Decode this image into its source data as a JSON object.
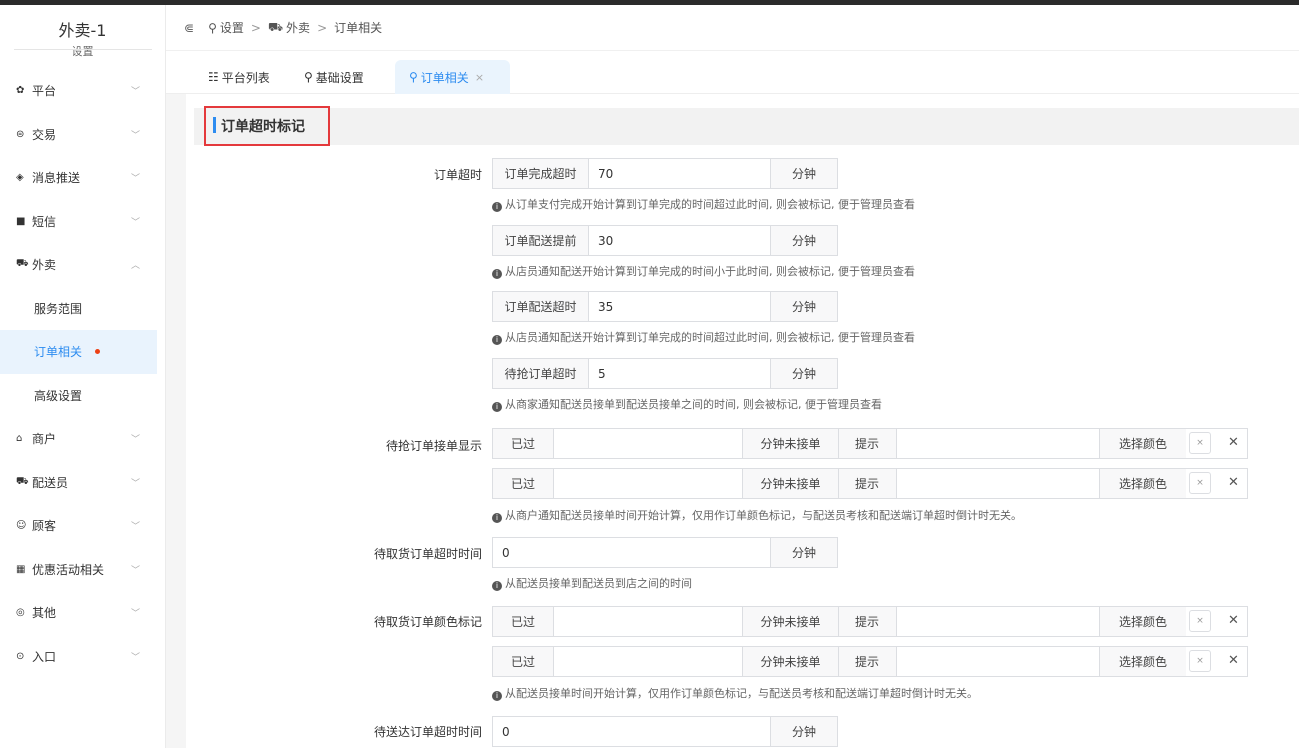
{
  "brand": {
    "title": "外卖-1",
    "subtitle": "设置"
  },
  "sidebar": {
    "items": [
      {
        "icon": "gear-icon",
        "glyph": "✿",
        "label": "平台"
      },
      {
        "icon": "trade-icon",
        "glyph": "⊜",
        "label": "交易"
      },
      {
        "icon": "message-icon",
        "glyph": "◈",
        "label": "消息推送"
      },
      {
        "icon": "sms-icon",
        "glyph": "■",
        "label": "短信"
      },
      {
        "icon": "takeout-icon",
        "glyph": "⛟",
        "label": "外卖"
      }
    ],
    "sub_items": [
      {
        "label": "服务范围"
      },
      {
        "label": "订单相关"
      },
      {
        "label": "高级设置"
      }
    ],
    "items_after": [
      {
        "icon": "shop-icon",
        "glyph": "⌂",
        "label": "商户"
      },
      {
        "icon": "rider-icon",
        "glyph": "⛟",
        "label": "配送员"
      },
      {
        "icon": "customer-icon",
        "glyph": "☺",
        "label": "顾客"
      },
      {
        "icon": "gift-icon",
        "glyph": "▦",
        "label": "优惠活动相关"
      },
      {
        "icon": "other-icon",
        "glyph": "◎",
        "label": "其他"
      },
      {
        "icon": "entry-icon",
        "glyph": "⊙",
        "label": "入口"
      }
    ]
  },
  "header": {
    "collapse_glyph": "⋐",
    "crumbs": [
      "设置",
      "外卖",
      "订单相关"
    ],
    "separator": ">"
  },
  "tabs": [
    {
      "label": "平台列表"
    },
    {
      "label": "基础设置"
    },
    {
      "label": "订单相关",
      "close": "×"
    }
  ],
  "section": {
    "title": "订单超时标记"
  },
  "form": {
    "order_timeout": {
      "label": "订单超时",
      "rows": [
        {
          "addon": "订单完成超时",
          "value": "70",
          "unit": "分钟",
          "hint": "从订单支付完成开始计算到订单完成的时间超过此时间, 则会被标记, 便于管理员查看"
        },
        {
          "addon": "订单配送提前",
          "value": "30",
          "unit": "分钟",
          "hint": "从店员通知配送开始计算到订单完成的时间小于此时间, 则会被标记, 便于管理员查看"
        },
        {
          "addon": "订单配送超时",
          "value": "35",
          "unit": "分钟",
          "hint": "从店员通知配送开始计算到订单完成的时间超过此时间, 则会被标记, 便于管理员查看"
        },
        {
          "addon": "待抢订单超时",
          "value": "5",
          "unit": "分钟",
          "hint": "从商家通知配送员接单到配送员接单之间的时间, 则会被标记, 便于管理员查看"
        }
      ]
    },
    "pending_grab_display": {
      "label": "待抢订单接单显示",
      "row_labels": {
        "passed": "已过",
        "minutes_not_taken": "分钟未接单",
        "tip": "提示",
        "choose_color": "选择颜色"
      },
      "hint": "从商户通知配送员接单时间开始计算，仅用作订单颜色标记，与配送员考核和配送端订单超时倒计时无关。"
    },
    "pickup_timeout": {
      "label": "待取货订单超时时间",
      "value": "0",
      "unit": "分钟",
      "hint": "从配送员接单到配送员到店之间的时间"
    },
    "pickup_color": {
      "label": "待取货订单颜色标记",
      "hint": "从配送员接单时间开始计算，仅用作订单颜色标记，与配送员考核和配送端订单超时倒计时无关。"
    },
    "delivery_timeout": {
      "label": "待送达订单超时时间",
      "value": "0",
      "unit": "分钟"
    }
  },
  "color_picker": {
    "empty_glyph": "×",
    "clear_glyph": "✕"
  },
  "hint_icon": "i"
}
